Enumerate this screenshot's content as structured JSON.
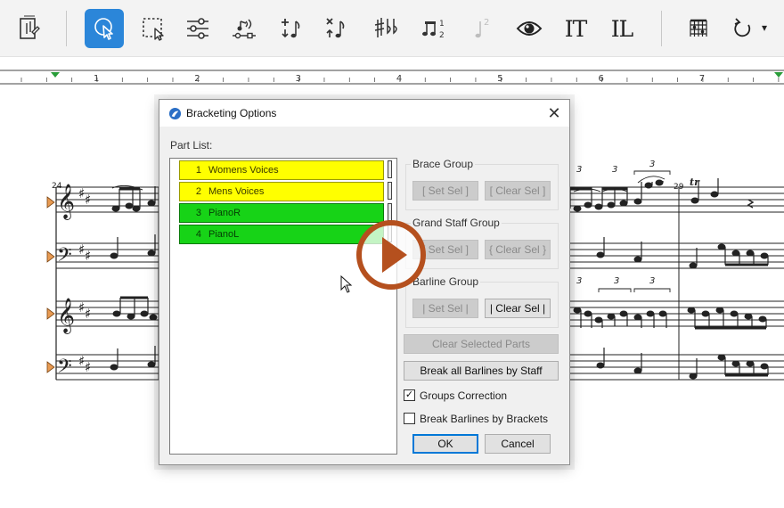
{
  "toolbar": {
    "icons": [
      "document-edit-icon",
      "pointer-icon",
      "marquee-select-icon",
      "sliders-icon",
      "playback-icon",
      "add-note-icon",
      "delete-note-icon",
      "accidentals-icon",
      "tuplet-icon",
      "note-disabled-icon",
      "eye-icon",
      "text-icon",
      "lyrics-icon",
      "chord-grid-icon",
      "undo-icon"
    ],
    "tuplet_label": "1 2",
    "note_disabled_label": "2",
    "text_tool_label": "IT",
    "lyrics_tool_label": "IL",
    "undo_dropdown": "▾",
    "active_color": "#2b86d9"
  },
  "ruler": {
    "labels": [
      "1",
      "2",
      "3",
      "4",
      "5",
      "6",
      "7"
    ],
    "marker_color": "#2a9d3a"
  },
  "score": {
    "measure_start": "24",
    "measure_right": "29",
    "tuplet": "3",
    "trill": "tr"
  },
  "dialog": {
    "title": "Bracketing Options",
    "close_label": "✕",
    "part_list_label": "Part List:",
    "parts": [
      {
        "num": "1",
        "name": "Womens Voices",
        "color": "#ffff00"
      },
      {
        "num": "2",
        "name": "Mens Voices",
        "color": "#ffff00"
      },
      {
        "num": "3",
        "name": "PianoR",
        "color": "#17d317"
      },
      {
        "num": "4",
        "name": "PianoL",
        "color": "#17d317"
      }
    ],
    "brace_group": {
      "title": "Brace Group",
      "set": "[ Set Sel ]",
      "clear": "[ Clear Sel ]"
    },
    "grand_staff_group": {
      "title": "Grand Staff Group",
      "set": "[ Set Sel ]",
      "clear": "{ Clear Sel }"
    },
    "barline_group": {
      "title": "Barline Group",
      "set": "| Set Sel |",
      "clear": "| Clear Sel |"
    },
    "clear_selected_parts": "Clear Selected Parts",
    "break_all_barlines": "Break all Barlines by Staff",
    "groups_correction": {
      "label": "Groups Correction",
      "checked": "✓"
    },
    "break_barlines_by_brackets": {
      "label": "Break Barlines by Brackets",
      "checked": ""
    },
    "ok": "OK",
    "cancel": "Cancel"
  },
  "overlay": {
    "play_color": "#b5501e"
  }
}
